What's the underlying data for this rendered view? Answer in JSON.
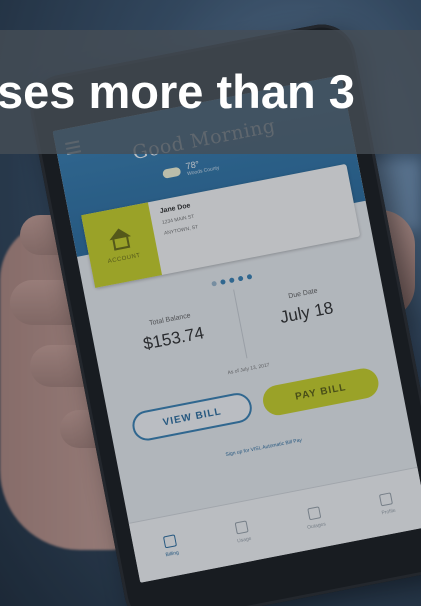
{
  "banner": {
    "text": "ses more than 3"
  },
  "app": {
    "greeting": "Good Morning",
    "temperature": "78°",
    "location": "Woods County",
    "account": {
      "tile_label": "ACCOUNT",
      "name": "Jane Doe",
      "line1": "1234 MAIN ST",
      "line2": "ANYTOWN, ST"
    },
    "balance": {
      "label": "Total Balance",
      "value": "$153.74"
    },
    "due": {
      "label": "Due Date",
      "value": "July 18"
    },
    "as_of": "As of July 13, 2017",
    "buttons": {
      "view": "VIEW BILL",
      "pay": "PAY BILL"
    },
    "autopay": "Sign up for VISL Automatic Bill Pay",
    "tabs": [
      "Billing",
      "Usage",
      "Outages",
      "Profile"
    ]
  },
  "colors": {
    "accent_blue": "#3d83b5",
    "accent_yellow": "#cad22b"
  }
}
